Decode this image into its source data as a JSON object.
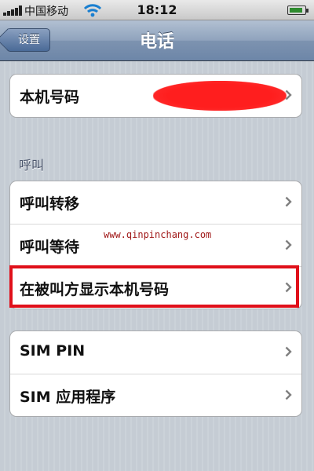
{
  "status_bar": {
    "carrier": "中国移动",
    "time": "18:12",
    "signal_icon": "signal-bars-icon",
    "wifi_icon": "wifi-icon",
    "battery_icon": "battery-icon",
    "battery_level": 0.9
  },
  "nav": {
    "back_label": "设置",
    "title": "电话"
  },
  "group1": {
    "items": [
      {
        "label": "本机号码",
        "value_redacted": true
      }
    ]
  },
  "section_calls": {
    "header": "呼叫",
    "items": [
      {
        "label": "呼叫转移"
      },
      {
        "label": "呼叫等待"
      },
      {
        "label": "在被叫方显示本机号码"
      }
    ]
  },
  "group3": {
    "items": [
      {
        "label": "SIM PIN"
      },
      {
        "label": "SIM 应用程序"
      }
    ]
  },
  "watermark": "www.qinpinchang.com",
  "colors": {
    "nav_bar": "#7d93b0",
    "highlight": "#e0101a",
    "redaction": "#ff1e1e"
  }
}
